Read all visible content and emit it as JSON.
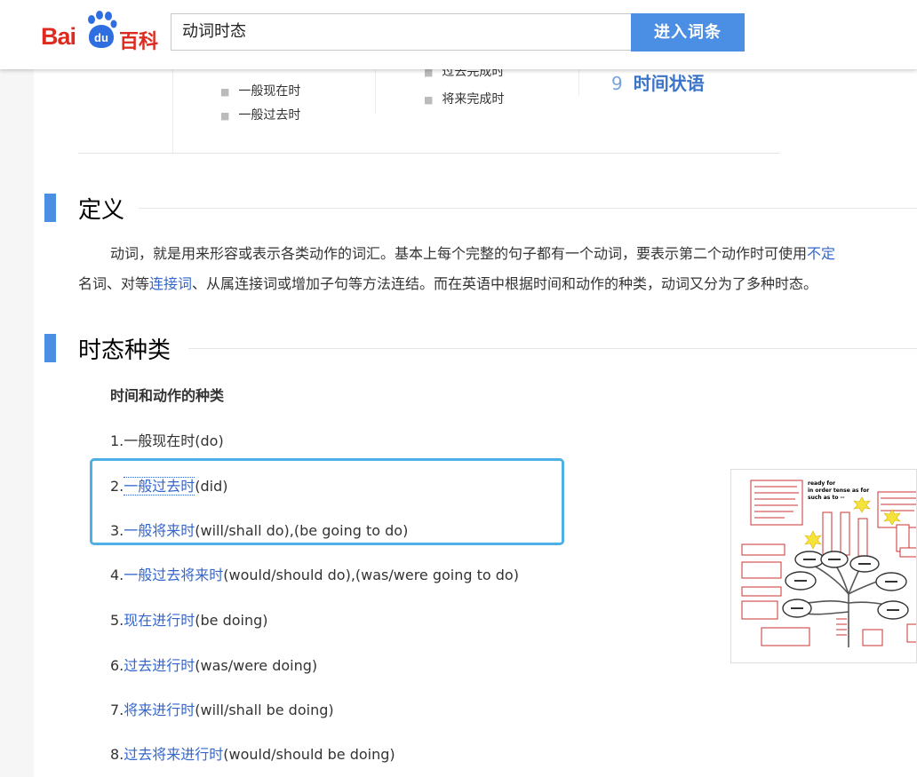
{
  "header": {
    "logo_bai": "Bai",
    "logo_du": "du",
    "logo_baike": "百科",
    "search_value": "动词时态",
    "search_button": "进入词条"
  },
  "toc": {
    "items_left": [
      "一般现在时",
      "一般过去时"
    ],
    "items_right": [
      "过去完成时",
      "将来完成时"
    ],
    "big_num": "9",
    "big_label": "时间状语"
  },
  "definition": {
    "title": "定义",
    "line1_text": "动词，就是用来形容或表示各类动作的词汇。基本上每个完整的句子都有一个动词，要表示第二个动作时可使用",
    "line1_link": "不定",
    "line2_a": "名词、对等",
    "line2_link": "连接词",
    "line2_b": "、从属连接词或增加子句等方法连结。而在英语中根据时间和动作的种类，动词又分为了多种时态。"
  },
  "tenses": {
    "title": "时态种类",
    "subheading": "时间和动作的种类",
    "items": [
      {
        "num": "1.",
        "link": "",
        "plain": "一般现在时",
        "suffix": "(do)"
      },
      {
        "num": "2.",
        "link": "一般过去时",
        "plain": "",
        "suffix": "(did)"
      },
      {
        "num": "3.",
        "link": "一般将来时",
        "plain": "",
        "suffix": "(will/shall do),(be going to do)"
      },
      {
        "num": "4.",
        "link": "一般过去将来时",
        "plain": "",
        "suffix": "(would/should do),(was/were going to do)"
      },
      {
        "num": "5.",
        "link": "现在进行时",
        "plain": "",
        "suffix": "(be doing)"
      },
      {
        "num": "6.",
        "link": "过去进行时",
        "plain": "",
        "suffix": "(was/were doing)"
      },
      {
        "num": "7.",
        "link": "将来进行时",
        "plain": "",
        "suffix": "(will/shall be doing)"
      },
      {
        "num": "8.",
        "link": "过去将来进行时",
        "plain": "",
        "suffix": "(would/should be doing)"
      }
    ]
  },
  "image": {
    "note1": "ready for",
    "note2": "in order tense as for",
    "note3": "such as to --"
  },
  "colors": {
    "accent": "#4b8fe5",
    "link": "#3366cc",
    "brand_red": "#de2b1f",
    "highlight": "#4eb0e6"
  }
}
